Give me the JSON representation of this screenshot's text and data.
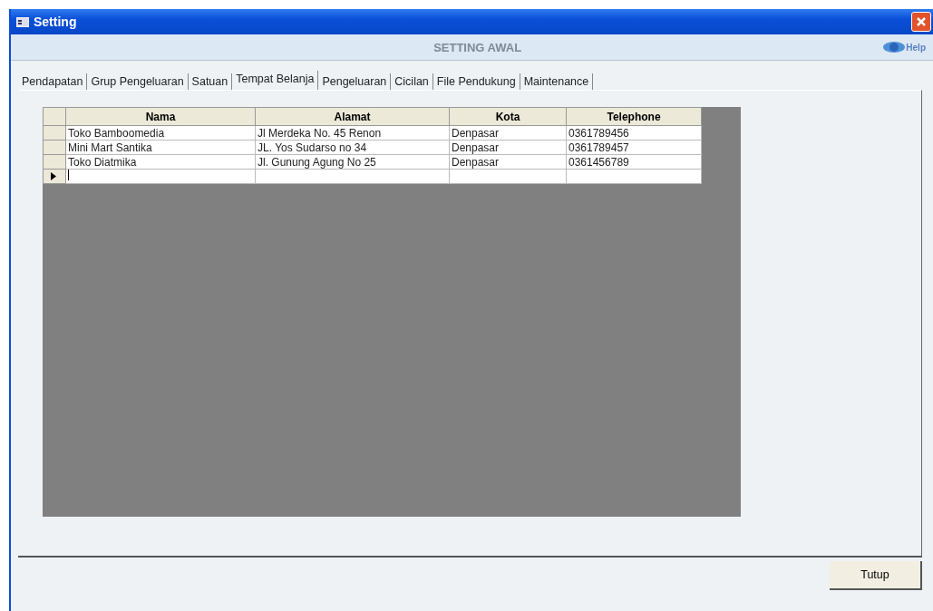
{
  "window": {
    "title": "Setting"
  },
  "header": {
    "title": "SETTING AWAL",
    "help": "Help"
  },
  "tabs": [
    {
      "label": "Pendapatan",
      "selected": false
    },
    {
      "label": "Grup Pengeluaran",
      "selected": false
    },
    {
      "label": "Satuan",
      "selected": false
    },
    {
      "label": "Tempat Belanja",
      "selected": true
    },
    {
      "label": "Pengeluaran",
      "selected": false
    },
    {
      "label": "Cicilan",
      "selected": false
    },
    {
      "label": "File Pendukung",
      "selected": false
    },
    {
      "label": "Maintenance",
      "selected": false
    }
  ],
  "table": {
    "columns": [
      "Nama",
      "Alamat",
      "Kota",
      "Telephone"
    ],
    "rows": [
      {
        "cells": [
          "Toko Bamboomedia",
          "Jl Merdeka No. 45 Renon",
          "Denpasar",
          "0361789456"
        ],
        "current": false
      },
      {
        "cells": [
          "Mini Mart Santika",
          "JL. Yos Sudarso no 34",
          "Denpasar",
          "0361789457"
        ],
        "current": false
      },
      {
        "cells": [
          "Toko Diatmika",
          "Jl. Gunung Agung No 25",
          "Denpasar",
          "0361456789"
        ],
        "current": false
      },
      {
        "cells": [],
        "current": true
      }
    ]
  },
  "buttons": [
    "Tutup"
  ]
}
